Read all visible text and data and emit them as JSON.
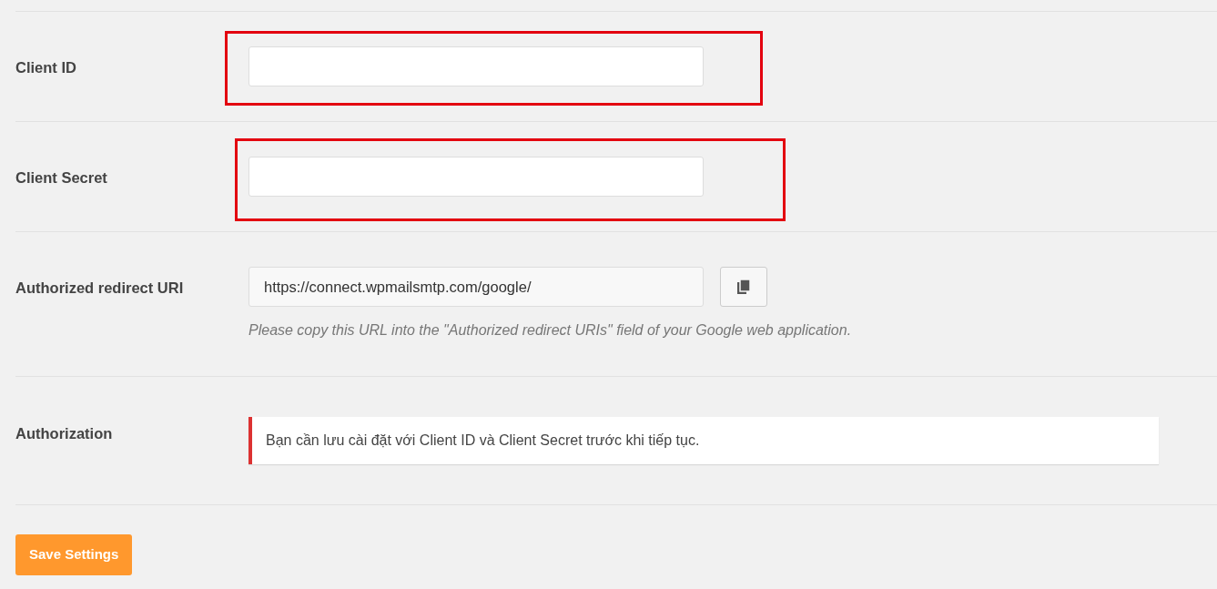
{
  "settings": [
    {
      "kind": "text",
      "label": "Client ID",
      "highlighted": true
    },
    {
      "kind": "text",
      "label": "Client Secret",
      "highlighted": true
    },
    {
      "kind": "copy",
      "label": "Authorized redirect URI",
      "value": "https://connect.wpmailsmtp.com/google/",
      "description": "Please copy this URL into the \"Authorized redirect URIs\" field of your Google web application.",
      "highlighted": false
    },
    {
      "kind": "notice",
      "label": "Authorization",
      "notice": "Bạn cần lưu cài đặt với Client ID và Client Secret trước khi tiếp tục.",
      "highlighted": false
    }
  ],
  "save_button": {
    "label": "Save Settings"
  }
}
